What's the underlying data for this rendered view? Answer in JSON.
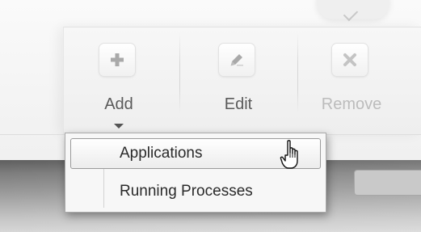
{
  "toolbar": {
    "buttons": [
      {
        "label": "Add",
        "icon": "plus-icon",
        "enabled": true
      },
      {
        "label": "Edit",
        "icon": "pencil-icon",
        "enabled": true
      },
      {
        "label": "Remove",
        "icon": "close-icon",
        "enabled": false
      }
    ]
  },
  "menu": {
    "items": [
      {
        "label": "Applications",
        "highlighted": true
      },
      {
        "label": "Running Processes",
        "highlighted": false
      }
    ]
  },
  "colors": {
    "icon_gray": "#a9a9a9",
    "label_gray": "#5a5a5a",
    "disabled_gray": "#bcbcbc",
    "menu_bg": "#f7f7f7"
  }
}
